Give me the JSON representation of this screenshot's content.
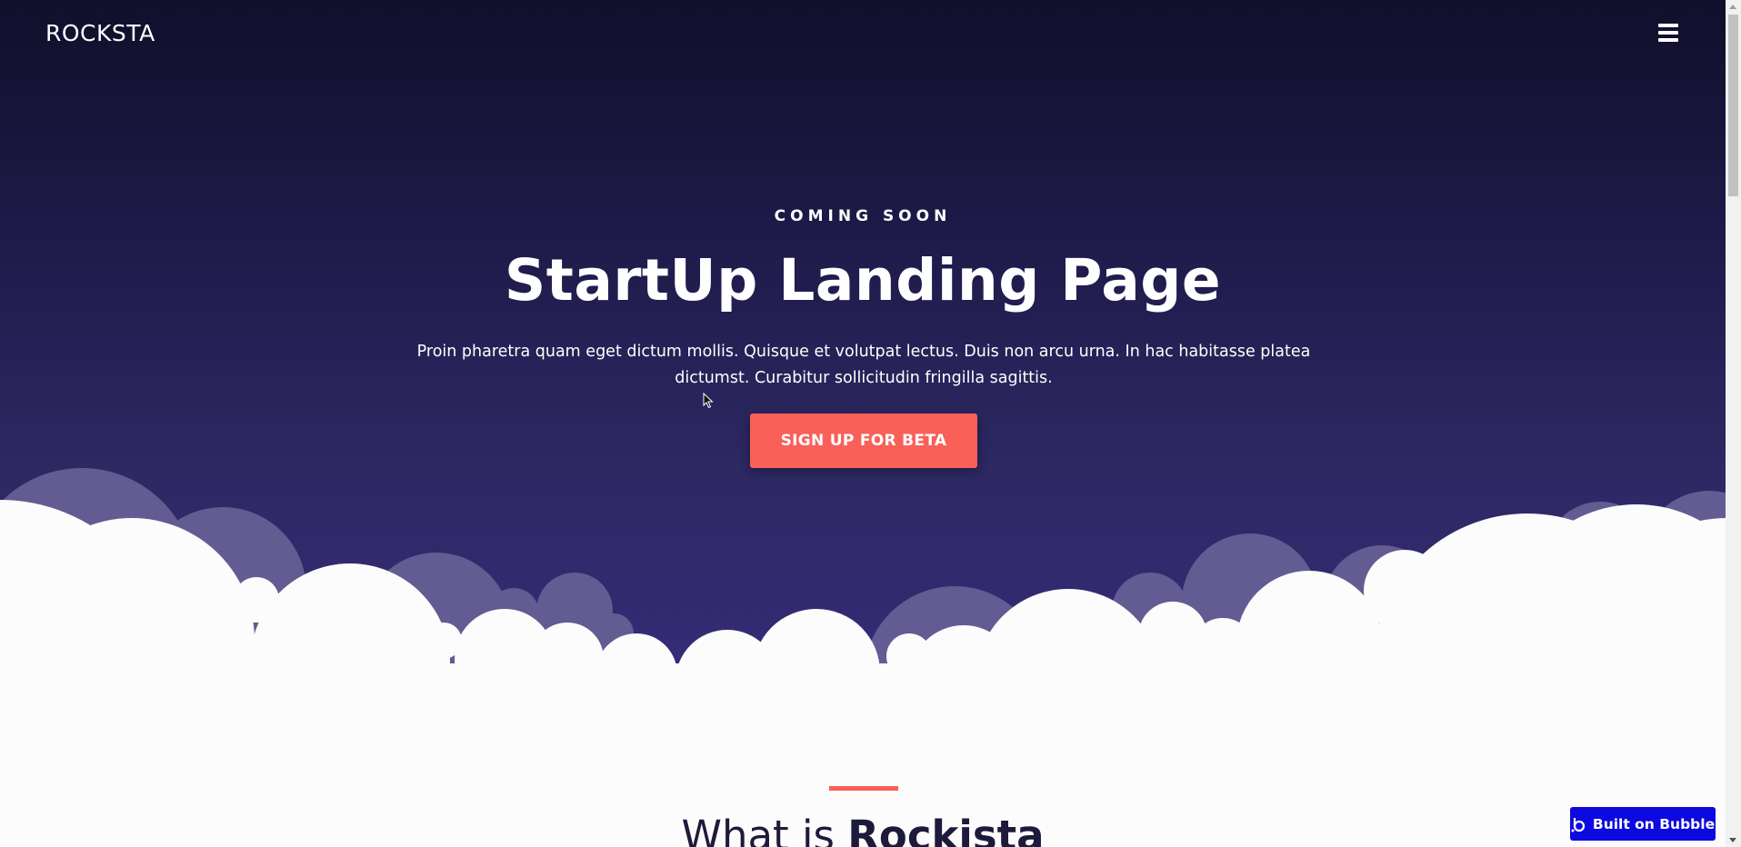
{
  "header": {
    "brand": "ROCKSTA",
    "menu_icon": "hamburger-menu-icon"
  },
  "hero": {
    "eyebrow": "COMING SOON",
    "title": "StartUp Landing Page",
    "subtitle_line1": "Proin pharetra quam eget dictum mollis. Quisque et volutpat lectus. Duis non arcu urna. In hac habitasse platea",
    "subtitle_line2": "dictumst. Curabitur sollicitudin fringilla sagittis.",
    "cta_label": "SIGN UP FOR BETA"
  },
  "section": {
    "title_prefix": "What is ",
    "title_bold": "Rockista"
  },
  "badge": {
    "label": "Built on Bubble",
    "icon": "bubble-logo-icon"
  },
  "colors": {
    "accent": "#f96058",
    "hero_dark": "#110f2b",
    "hero_light": "#3a318a",
    "back_clouds": "#625c92",
    "badge_bg": "#0d0ae0"
  }
}
